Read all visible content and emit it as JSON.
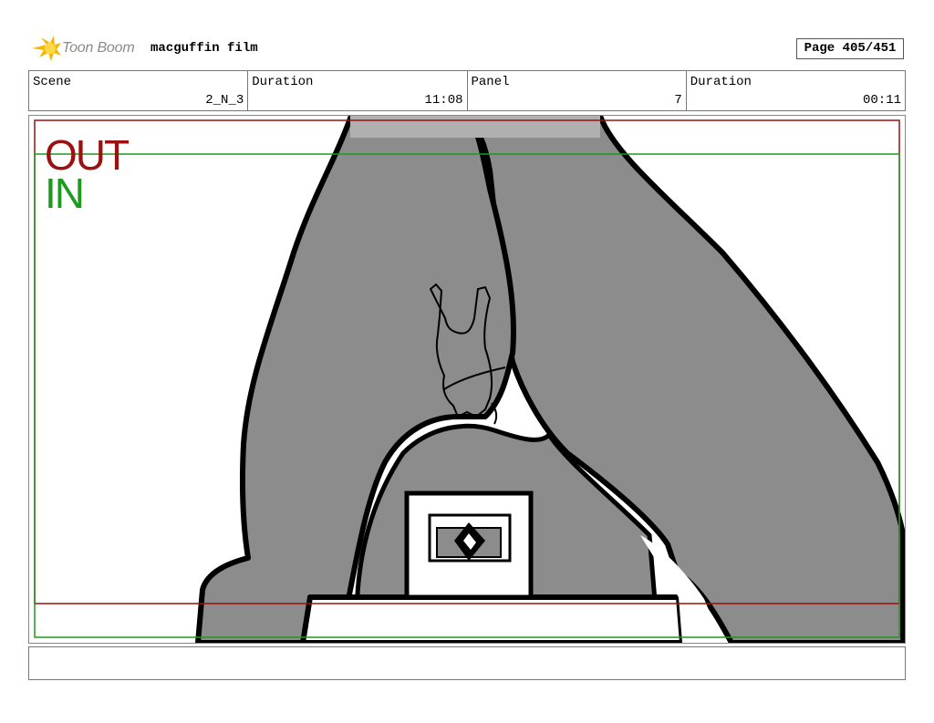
{
  "header": {
    "logo_text": "Toon Boom",
    "project_title": "macguffin film",
    "page_label": "Page 405/451"
  },
  "info_row": [
    {
      "label": "Scene",
      "value": "2_N_3"
    },
    {
      "label": "Duration",
      "value": "11:08"
    },
    {
      "label": "Panel",
      "value": "7"
    },
    {
      "label": "Duration",
      "value": "00:11"
    }
  ],
  "panel": {
    "out_label": "OUT",
    "in_label": "IN",
    "colors": {
      "out_frame": "#9b1010",
      "in_frame": "#1d9a1d",
      "figure_fill": "#8c8c8c"
    }
  },
  "notes": {
    "text": ""
  }
}
